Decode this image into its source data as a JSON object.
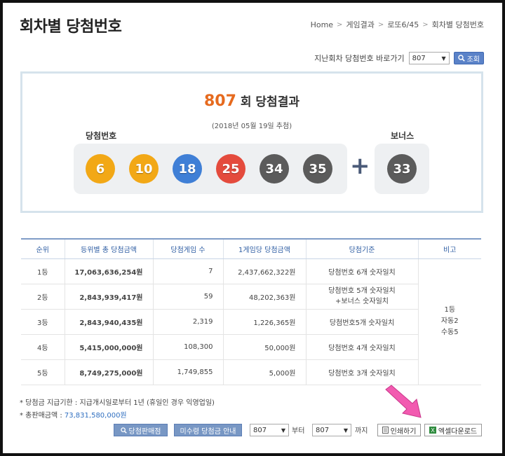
{
  "page": {
    "title": "회차별 당첨번호",
    "breadcrumb": [
      "Home",
      "게임결과",
      "로또6/45",
      "회차별 당첨번호"
    ]
  },
  "jump": {
    "label": "지난회차 당첨번호 바로가기",
    "selected": "807",
    "button": "조회"
  },
  "result": {
    "round": "807",
    "round_suffix": "회 당첨결과",
    "date": "(2018년 05월 19일 추첨)",
    "win_label": "당첨번호",
    "bonus_label": "보너스",
    "numbers": [
      "6",
      "10",
      "18",
      "25",
      "34",
      "35"
    ],
    "plus": "+",
    "bonus": "33",
    "colors": {
      "yellow": "#f2a816",
      "blue": "#3f7fd6",
      "red": "#e44b3d",
      "gray": "#5b5b5b"
    }
  },
  "table": {
    "headers": [
      "순위",
      "등위별 총 당첨금액",
      "당첨게임 수",
      "1게임당 당첨금액",
      "당첨기준",
      "비고"
    ],
    "rows": [
      {
        "rank": "1등",
        "total": "17,063,636,254원",
        "count": "7",
        "per": "2,437,662,322원",
        "criteria": [
          "당첨번호 6개 숫자일치"
        ]
      },
      {
        "rank": "2등",
        "total": "2,843,939,417원",
        "count": "59",
        "per": "48,202,363원",
        "criteria": [
          "당첨번호 5개 숫자일치",
          "+보너스 숫자일치"
        ]
      },
      {
        "rank": "3등",
        "total": "2,843,940,435원",
        "count": "2,319",
        "per": "1,226,365원",
        "criteria": [
          "당첨번호5개 숫자일치"
        ]
      },
      {
        "rank": "4등",
        "total": "5,415,000,000원",
        "count": "108,300",
        "per": "50,000원",
        "criteria": [
          "당첨번호 4개 숫자일치"
        ]
      },
      {
        "rank": "5등",
        "total": "8,749,275,000원",
        "count": "1,749,855",
        "per": "5,000원",
        "criteria": [
          "당첨번호 3개 숫자일치"
        ]
      }
    ],
    "note": [
      "1등",
      "자동2",
      "수동5"
    ]
  },
  "footer": {
    "note1": "* 당첨금 지급기한 : 지급개시일로부터 1년 (휴일인 경우 익영업일)",
    "note2_label": "* 총판매금액 : ",
    "note2_value": "73,831,580,000원",
    "btn_stores": "당첨판매점",
    "btn_unclaimed": "미수령 당첨금 안내",
    "from_value": "807",
    "from_label": "부터",
    "to_value": "807",
    "to_label": "까지",
    "btn_print": "인쇄하기",
    "btn_excel": "엑셀다운로드"
  },
  "colors": {
    "accent_orange": "#e66a1e",
    "header_blue": "#2f5ea3",
    "arrow_pink": "#f25ab0"
  }
}
